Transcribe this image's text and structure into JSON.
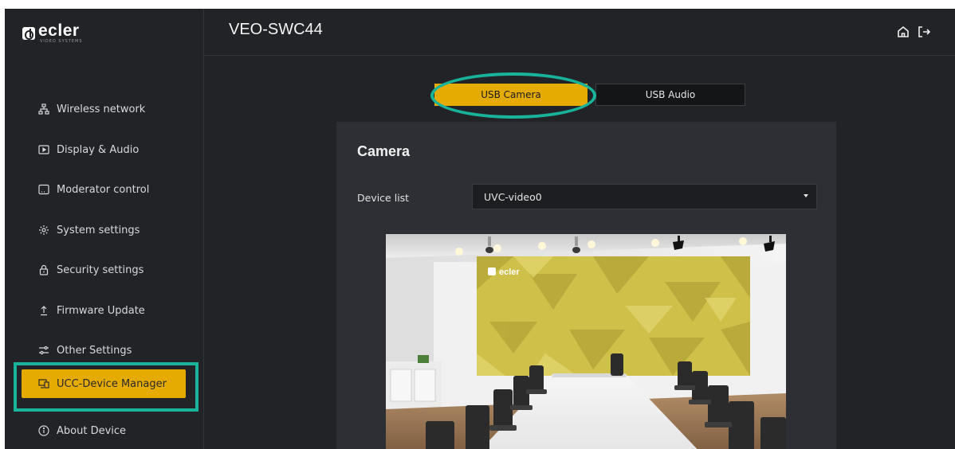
{
  "brand": {
    "name": "ecler",
    "tagline": "VIDEO SYSTEMS"
  },
  "header": {
    "device_name": "VEO-SWC44",
    "home_icon": "home-icon",
    "logout_icon": "logout-icon"
  },
  "sidebar": {
    "items": [
      {
        "label": "Wireless network",
        "icon": "network-icon"
      },
      {
        "label": "Display & Audio",
        "icon": "display-icon"
      },
      {
        "label": "Moderator control",
        "icon": "moderator-icon"
      },
      {
        "label": "System settings",
        "icon": "gear-icon"
      },
      {
        "label": "Security settings",
        "icon": "lock-icon"
      },
      {
        "label": "Firmware Update",
        "icon": "upload-icon"
      },
      {
        "label": "Other Settings",
        "icon": "sliders-icon"
      },
      {
        "label": "UCC-Device Manager",
        "icon": "device-manager-icon",
        "active": true
      },
      {
        "label": "About Device",
        "icon": "info-icon"
      }
    ]
  },
  "tabs": [
    {
      "label": "USB Camera",
      "active": true
    },
    {
      "label": "USB Audio",
      "active": false
    }
  ],
  "camera": {
    "title": "Camera",
    "device_list_label": "Device list",
    "device_list_value": "UVC-video0",
    "preview_logo": "ecler"
  },
  "colors": {
    "accent": "#e6ab00",
    "highlight": "#19b29a",
    "background": "#222327",
    "panel": "#2e2f34"
  }
}
